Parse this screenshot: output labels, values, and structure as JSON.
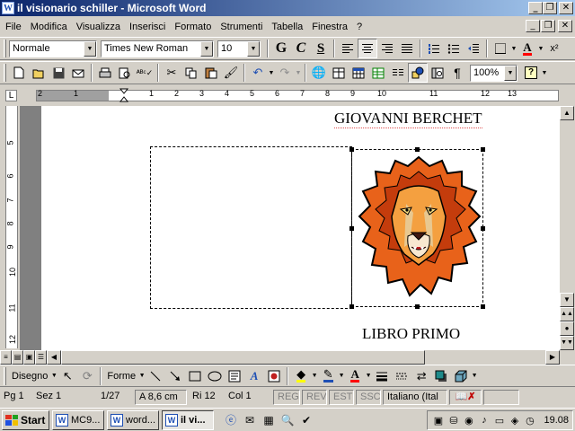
{
  "window": {
    "title": "il visionario schiller - Microsoft Word",
    "app_icon": "W",
    "controls": [
      "minimize-icon",
      "restore-icon",
      "close-icon"
    ]
  },
  "menu": {
    "items": [
      "File",
      "Modifica",
      "Visualizza",
      "Inserisci",
      "Formato",
      "Strumenti",
      "Tabella",
      "Finestra",
      "?"
    ]
  },
  "format_toolbar": {
    "style": "Normale",
    "font": "Times New Roman",
    "size": "10",
    "bold": "G",
    "italic": "C",
    "underline": "S",
    "alignment_selected": "center",
    "font_color": "#ff0000",
    "superscript": "x²"
  },
  "standard_toolbar": {
    "zoom": "100%"
  },
  "ruler": {
    "h_numbers": [
      "2",
      "1",
      "1",
      "2",
      "3",
      "4",
      "5",
      "6",
      "7",
      "8",
      "9",
      "10",
      "11",
      "12",
      "13"
    ],
    "v_numbers": [
      "5",
      "6",
      "7",
      "8",
      "9",
      "10",
      "11",
      "12"
    ]
  },
  "document": {
    "heading": "GIOVANNI BERCHET",
    "subheading": "LIBRO PRIMO",
    "picture": "lion-head"
  },
  "drawing_toolbar": {
    "draw_label": "Disegno",
    "shapes_label": "Forme"
  },
  "status": {
    "page": "Pg 1",
    "section": "Sez 1",
    "pages": "1/27",
    "at": "A 8,6 cm",
    "line": "Ri 12",
    "col": "Col 1",
    "modes": [
      "REG",
      "REV",
      "EST",
      "SSC"
    ],
    "language": "Italiano (Ital"
  },
  "taskbar": {
    "start": "Start",
    "tasks": [
      {
        "label": "MC9...",
        "active": false
      },
      {
        "label": "word...",
        "active": false
      },
      {
        "label": "il vi...",
        "active": true
      }
    ],
    "clock": "19.08"
  },
  "colors": {
    "titlebar_start": "#0a246a",
    "titlebar_end": "#a6caf0",
    "face": "#d4d0c8",
    "lion_mane": "#e8621a"
  }
}
